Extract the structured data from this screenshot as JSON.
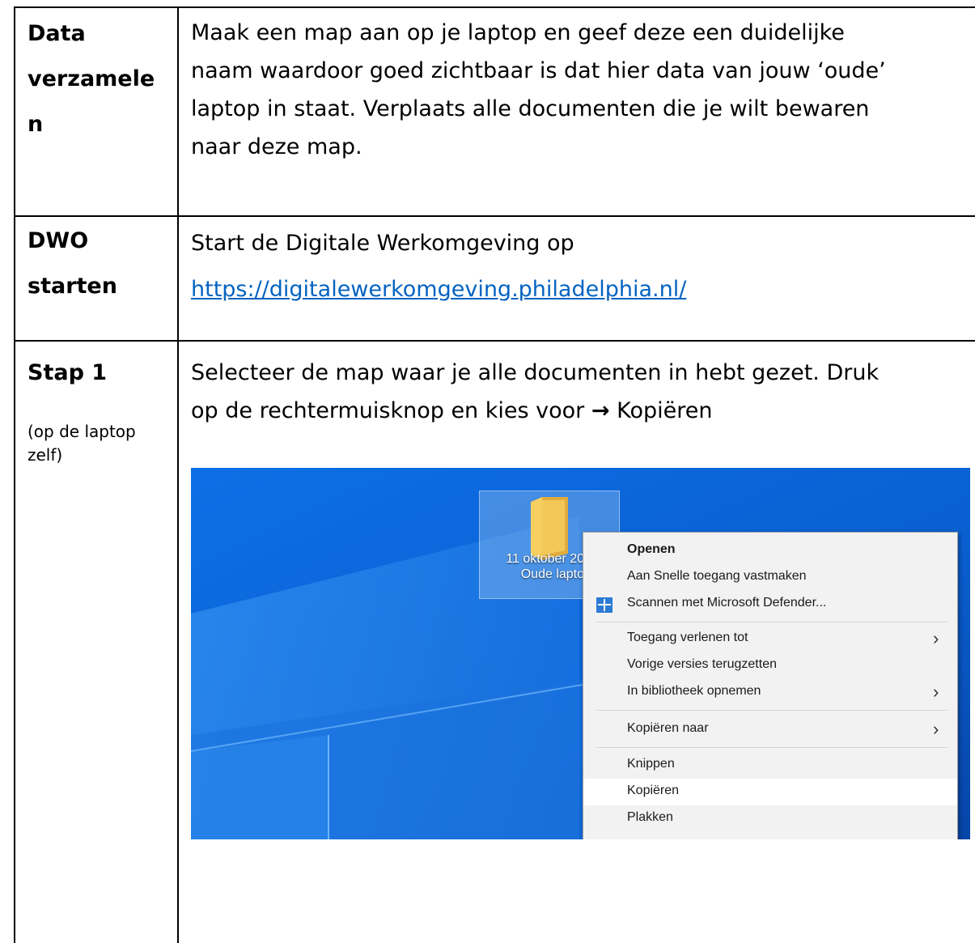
{
  "rows": [
    {
      "label": "Data verzamele n",
      "label_lines": [
        "Data",
        "verzamele",
        "n"
      ],
      "lines": [
        "Maak een map aan op je laptop en geef deze een duidelijke",
        "naam waardoor goed zichtbaar is dat hier data van jouw ‘oude’",
        "laptop in staat. Verplaats alle documenten die je wilt bewaren",
        "naar deze map."
      ]
    },
    {
      "label": "DWO starten",
      "label_lines": [
        "DWO",
        "starten"
      ],
      "text": "Start de Digitale Werkomgeving op",
      "link": "https://digitalewerkomgeving.philadelphia.nl/"
    },
    {
      "label": "Stap 1",
      "sublabel_lines": [
        "(op de laptop",
        "zelf)"
      ],
      "lines": [
        "Selecteer de map waar je alle documenten in hebt gezet. Druk",
        "op de rechtermuisknop en kies voor"
      ],
      "arrow": "→",
      "action": "Kopiëren"
    }
  ],
  "screenshot": {
    "folder_label_lines": [
      "11 oktober 20",
      "Oude lapto"
    ],
    "folder_icon": "folder-icon",
    "context_menu": [
      {
        "label": "Openen",
        "bold": true
      },
      {
        "label": "Aan Snelle toegang vastmaken"
      },
      {
        "label": "Scannen met Microsoft Defender...",
        "icon": "defender-shield-icon"
      },
      {
        "separator": true
      },
      {
        "label": "Toegang verlenen tot",
        "submenu": true
      },
      {
        "label": "Vorige versies terugzetten"
      },
      {
        "label": "In bibliotheek opnemen",
        "submenu": true
      },
      {
        "separator": true
      },
      {
        "label": "Kopiëren naar",
        "submenu": true
      },
      {
        "separator": true
      },
      {
        "label": "Knippen"
      },
      {
        "label": "Kopiëren",
        "highlighted": true
      },
      {
        "label": "Plakken"
      }
    ],
    "colors": {
      "desktop": "#0a63d6",
      "menu_bg": "#f2f2f2",
      "link": "#0563c1"
    }
  }
}
